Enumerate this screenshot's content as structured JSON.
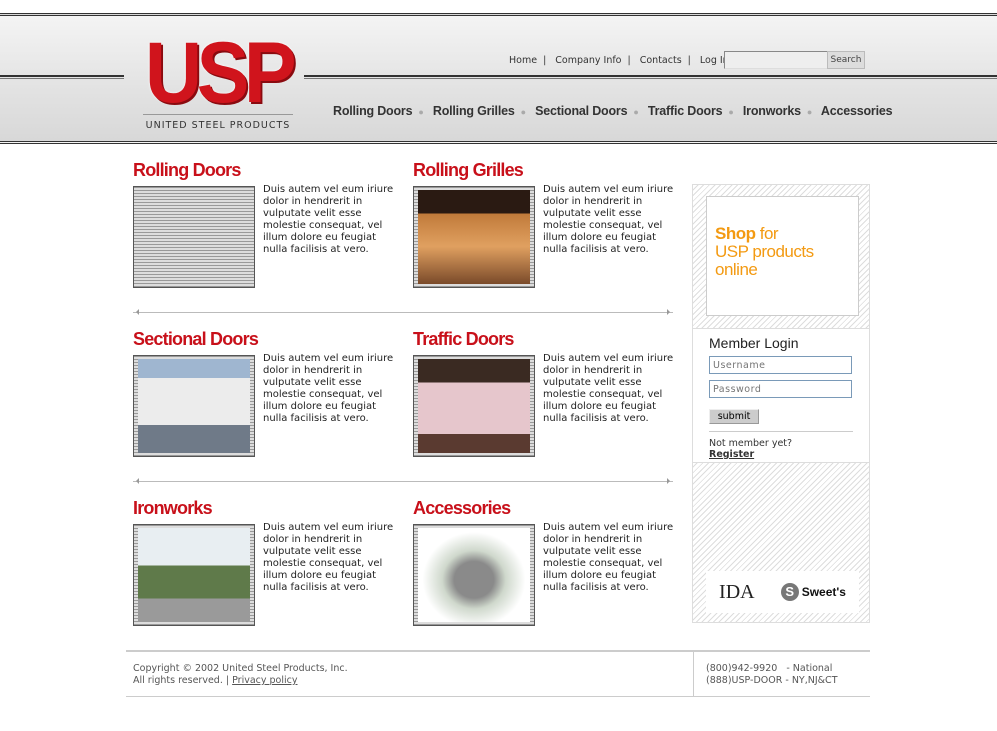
{
  "header": {
    "logo": "USP",
    "logo_subtitle": "UNITED STEEL PRODUCTS",
    "top_links": [
      "Home",
      "Company Info",
      "Contacts",
      "Log In"
    ],
    "search_placeholder": "",
    "search_button": "Search",
    "nav": [
      "Rolling Doors",
      "Rolling Grilles",
      "Sectional Doors",
      "Traffic Doors",
      "Ironworks",
      "Accessories"
    ]
  },
  "products": [
    {
      "title": "Rolling Doors",
      "description": "Duis autem vel eum iriure dolor in hendrerit in vulputate velit esse molestie consequat, vel illum dolore eu feugiat nulla facilisis at vero."
    },
    {
      "title": "Rolling Grilles",
      "description": "Duis autem vel eum iriure dolor in hendrerit in vulputate velit esse molestie consequat, vel illum dolore eu feugiat nulla facilisis at vero."
    },
    {
      "title": "Sectional Doors",
      "description": "Duis autem vel eum iriure dolor in hendrerit in vulputate velit esse molestie consequat, vel illum dolore eu feugiat nulla facilisis at vero."
    },
    {
      "title": "Traffic Doors",
      "description": "Duis autem vel eum iriure dolor in hendrerit in vulputate velit esse molestie consequat, vel illum dolore eu feugiat nulla facilisis at vero."
    },
    {
      "title": "Ironworks",
      "description": "Duis autem vel eum iriure dolor in hendrerit in vulputate velit esse molestie consequat, vel illum dolore eu feugiat nulla facilisis at vero."
    },
    {
      "title": "Accessories",
      "description": "Duis autem vel eum iriure dolor in hendrerit in vulputate velit esse molestie consequat, vel illum dolore eu feugiat nulla facilisis at vero."
    }
  ],
  "sidebar": {
    "shop_bold": "Shop",
    "shop_rest": " for",
    "shop_line2": "USP products",
    "shop_line3": "online",
    "login_title": "Member Login",
    "username_placeholder": "Username",
    "password_placeholder": "Password",
    "submit": "submit",
    "not_member": "Not member yet?",
    "register": "Register",
    "logo_ida": "IDA",
    "logo_sweets": "Sweet's"
  },
  "footer": {
    "copyright": "Copyright © 2002 United Steel Products, Inc.",
    "rights": "All rights reserved.",
    "privacy": "Privacy policy",
    "phone1": "(800)942-9920   - National",
    "phone2": "(888)USP-DOOR - NY,NJ&CT"
  }
}
